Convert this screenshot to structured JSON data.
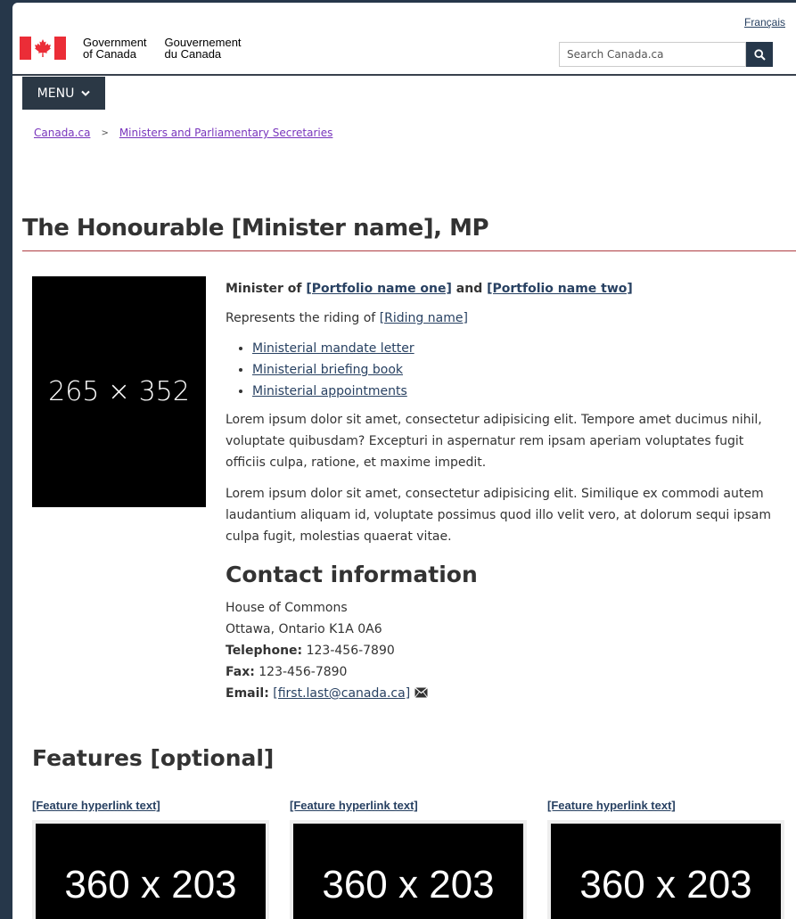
{
  "header": {
    "language_link": "Français",
    "signature_en_line1": "Government",
    "signature_en_line2": "of Canada",
    "signature_fr_line1": "Gouvernement",
    "signature_fr_line2": "du Canada",
    "search_placeholder": "Search Canada.ca",
    "menu_label": "MENU"
  },
  "breadcrumb": [
    {
      "label": "Canada.ca"
    },
    {
      "label": "Ministers and Parliamentary Secretaries"
    }
  ],
  "page": {
    "title": "The Honourable [Minister name], MP",
    "portrait_label": "265 × 352",
    "minister_prefix": "Minister of ",
    "portfolio_one": "[Portfolio name one]",
    "minister_and": " and ",
    "portfolio_two": "[Portfolio name two]",
    "riding_prefix": "Represents the riding of ",
    "riding_name": "[Riding name]",
    "links": [
      "Ministerial mandate letter",
      "Ministerial briefing book",
      "Ministerial appointments"
    ],
    "paragraph1": "Lorem ipsum dolor sit amet, consectetur adipisicing elit. Tempore amet ducimus nihil, voluptate quibusdam? Excepturi in aspernatur rem ipsam aperiam voluptates fugit officiis culpa, ratione, et maxime impedit.",
    "paragraph2": "Lorem ipsum dolor sit amet, consectetur adipisicing elit. Similique ex commodi autem laudantium aliquam id, voluptate possimus quod illo velit vero, at dolorum sequi ipsam culpa fugit, molestias quaerat vitae."
  },
  "contact": {
    "heading": "Contact information",
    "address1": "House of Commons",
    "address2": "Ottawa, Ontario K1A 0A6",
    "telephone_label": "Telephone:",
    "telephone": " 123-456-7890",
    "fax_label": "Fax:",
    "fax": " 123-456-7890",
    "email_label": "Email:",
    "email": "[first.last@canada.ca]"
  },
  "features": {
    "heading": "Features [optional]",
    "items": [
      {
        "link": "[Feature hyperlink text]",
        "thumb": "360 x 203"
      },
      {
        "link": "[Feature hyperlink text]",
        "thumb": "360 x 203"
      },
      {
        "link": "[Feature hyperlink text]",
        "thumb": "360 x 203"
      }
    ]
  },
  "colors": {
    "brand_navy": "#26374a",
    "flag_red": "#eb2d37",
    "link": "#284162",
    "visited_link": "#7834bc",
    "title_rule": "#af3c43"
  }
}
